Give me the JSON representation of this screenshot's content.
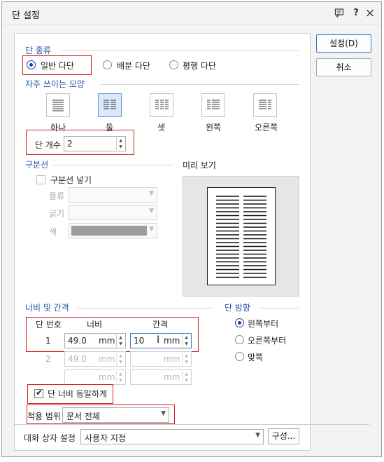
{
  "dialog": {
    "title": "단 설정"
  },
  "titlebar": {
    "help_icon": "help-icon",
    "question": "?",
    "close": "×"
  },
  "buttons": {
    "ok": "설정(D)",
    "cancel": "취소"
  },
  "column_type": {
    "label": "단 종류",
    "options": [
      "일반 다단",
      "배분 다단",
      "평행 다단"
    ],
    "selected": "일반 다단"
  },
  "presets": {
    "label": "자주 쓰이는 모양",
    "items": [
      "하나",
      "둘",
      "셋",
      "왼쪽",
      "오른쪽"
    ],
    "selected": "둘"
  },
  "column_count": {
    "label": "단 개수",
    "value": "2"
  },
  "divider": {
    "label": "구분선",
    "insert_label": "구분선 넣기",
    "type_label": "종류",
    "thickness_label": "굵기",
    "color_label": "색",
    "color_value": "#9c9c9c"
  },
  "preview": {
    "label": "미리 보기"
  },
  "width_spacing": {
    "label": "너비 및 간격",
    "col_header": "단 번호",
    "width_header": "너비",
    "gap_header": "간격",
    "rows": [
      {
        "num": "1",
        "width": "49.0",
        "width_unit": "mm",
        "gap": "10",
        "gap_unit": "mm"
      },
      {
        "num": "2",
        "width": "49.0",
        "width_unit": "mm",
        "gap": "",
        "gap_unit": "mm"
      },
      {
        "num": "",
        "width": "",
        "width_unit": "mm",
        "gap": "",
        "gap_unit": "mm"
      }
    ]
  },
  "direction": {
    "label": "단 방향",
    "options": [
      "왼쪽부터",
      "오른쪽부터",
      "맞쪽"
    ],
    "selected": "왼쪽부터"
  },
  "equal_width": {
    "label": "단 너비 동일하게",
    "checked": true
  },
  "apply_to": {
    "label": "적용 범위",
    "value": "문서 전체"
  },
  "dialog_settings": {
    "label": "대화 상자 설정",
    "value": "사용자 지정",
    "configure_button": "구성..."
  }
}
